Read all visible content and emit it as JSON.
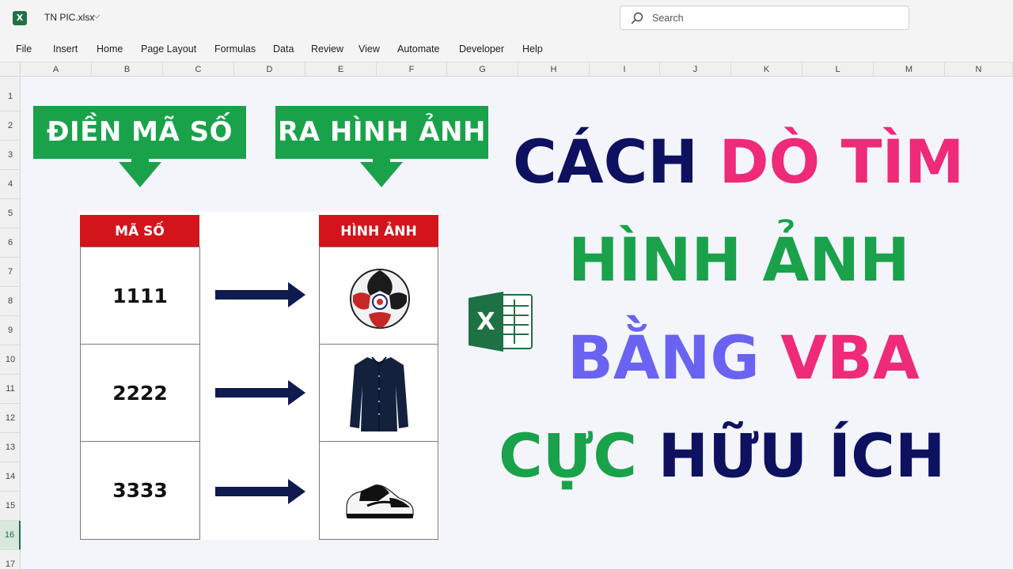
{
  "window": {
    "app_icon": "excel-app-icon",
    "file_name": "TN PIC.xlsx",
    "search_placeholder": "Search"
  },
  "menu": [
    "File",
    "Insert",
    "Home",
    "Page Layout",
    "Formulas",
    "Data",
    "Review",
    "View",
    "Automate",
    "Developer",
    "Help"
  ],
  "columns": [
    "A",
    "B",
    "C",
    "D",
    "E",
    "F",
    "G",
    "H",
    "I",
    "J",
    "K",
    "L",
    "M",
    "N"
  ],
  "rows": [
    "1",
    "2",
    "3",
    "4",
    "5",
    "6",
    "7",
    "8",
    "9",
    "10",
    "11",
    "12",
    "13",
    "14",
    "15",
    "16",
    "17"
  ],
  "active_row": "16",
  "banners": {
    "left": "ĐIỀN MÃ SỐ",
    "right": "RA HÌNH ẢNH",
    "color": "#19a24a"
  },
  "table": {
    "header_left": "MÃ SỐ",
    "header_right": "HÌNH ẢNH",
    "header_color": "#d3141b",
    "rows": [
      {
        "code": "1111",
        "image": "soccer-ball-image"
      },
      {
        "code": "2222",
        "image": "navy-shirt-image"
      },
      {
        "code": "3333",
        "image": "sneaker-image"
      }
    ]
  },
  "headline": {
    "line1": [
      {
        "text": "CÁCH",
        "color": "#0d1160"
      },
      {
        "text": "DÒ TÌM",
        "color": "#ee2a79"
      }
    ],
    "line2": [
      {
        "text": "HÌNH ẢNH",
        "color": "#19a24a"
      }
    ],
    "line3": [
      {
        "text": "BẰNG",
        "color": "#6a63f2"
      },
      {
        "text": "VBA",
        "color": "#ee2a79"
      }
    ],
    "line4": [
      {
        "text": "CỰC",
        "color": "#19a24a"
      },
      {
        "text": "HỮU ÍCH",
        "color": "#0d1160"
      }
    ]
  }
}
